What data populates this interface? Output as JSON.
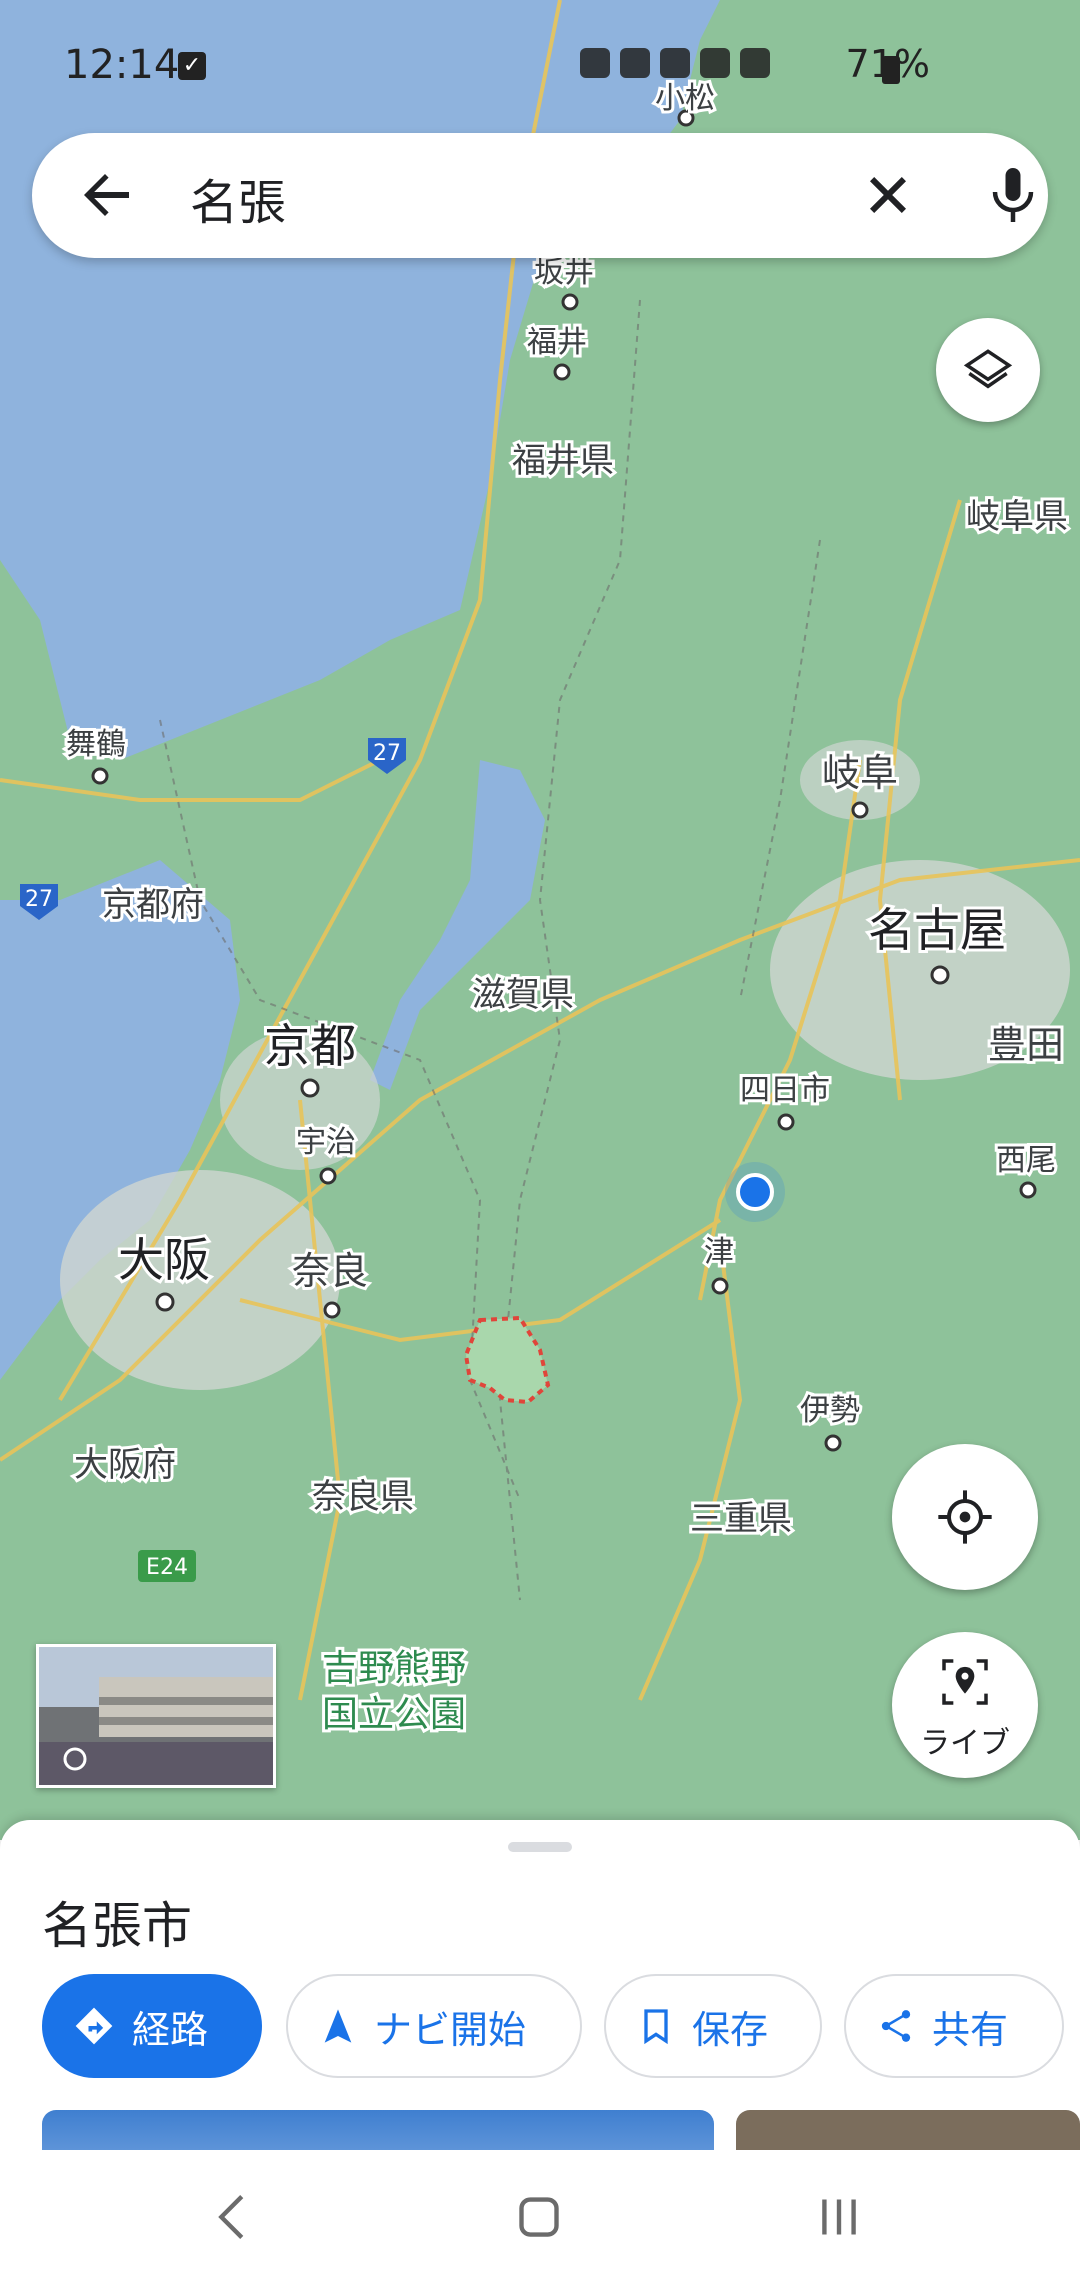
{
  "status_bar": {
    "time": "12:14",
    "battery": "71%"
  },
  "search": {
    "query": "名張"
  },
  "map_labels": {
    "komatsu": "小松",
    "sakai": "坂井",
    "fukui": "福井",
    "fukui_pref": "福井県",
    "gifu_pref": "岐阜県",
    "maizuru": "舞鶴",
    "kyoto_pref": "京都府",
    "gifu": "岐阜",
    "nagoya": "名古屋",
    "shiga_pref": "滋賀県",
    "kyoto": "京都",
    "toyota": "豊田",
    "yokkaichi": "四日市",
    "uji": "宇治",
    "nishio": "西尾",
    "osaka": "大阪",
    "nara": "奈良",
    "tsu": "津",
    "ise": "伊勢",
    "osaka_pref": "大阪府",
    "nara_pref": "奈良県",
    "mie_pref": "三重県",
    "park_line1": "吉野熊野",
    "park_line2": "国立公園",
    "road_27": "27",
    "road_e24": "E24"
  },
  "live_button": {
    "label": "ライブ"
  },
  "place_sheet": {
    "title": "名張市",
    "actions": [
      {
        "label": "経路"
      },
      {
        "label": "ナビ開始"
      },
      {
        "label": "保存"
      },
      {
        "label": "共有"
      }
    ]
  },
  "colors": {
    "accent": "#1a73e8",
    "water": "#8fb3dd",
    "land": "#8ec29a"
  }
}
